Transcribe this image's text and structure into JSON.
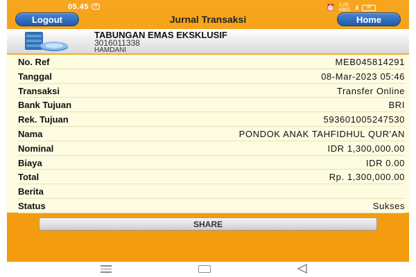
{
  "status_bar": {
    "time": "05.45",
    "app_badge": "M",
    "speed_top": "2,00",
    "speed_bottom": "KB/S",
    "signal": ".ıll",
    "battery": "36"
  },
  "header": {
    "logout_label": "Logout",
    "title": "Jurnal Transaksi",
    "home_label": "Home"
  },
  "account": {
    "name": "TABUNGAN EMAS EKSKLUSIF",
    "number": "3016011338",
    "owner": "HAMDANI"
  },
  "details": [
    {
      "label": "No. Ref",
      "value": "MEB045814291"
    },
    {
      "label": "Tanggal",
      "value": "08-Mar-2023 05:46"
    },
    {
      "label": "Transaksi",
      "value": "Transfer Online"
    },
    {
      "label": "Bank Tujuan",
      "value": "BRI"
    },
    {
      "label": "Rek. Tujuan",
      "value": "593601005247530"
    },
    {
      "label": "Nama",
      "value": "PONDOK ANAK TAHFIDHUL QUR'AN"
    },
    {
      "label": "Nominal",
      "value": "IDR 1,300,000.00"
    },
    {
      "label": "Biaya",
      "value": "IDR 0.00"
    },
    {
      "label": "Total",
      "value": "Rp. 1,300,000.00"
    },
    {
      "label": "Berita",
      "value": ""
    },
    {
      "label": "Status",
      "value": "Sukses"
    }
  ],
  "share_label": "SHARE",
  "icons": {
    "account": "coin-stack-icon",
    "nav_menu": "recent-apps-icon",
    "nav_home": "home-square-icon",
    "nav_back": "back-triangle-icon"
  },
  "colors": {
    "background": "#f39a0e",
    "nav_button": "#1f5aa8",
    "table_bg": "#fdfbe0"
  }
}
